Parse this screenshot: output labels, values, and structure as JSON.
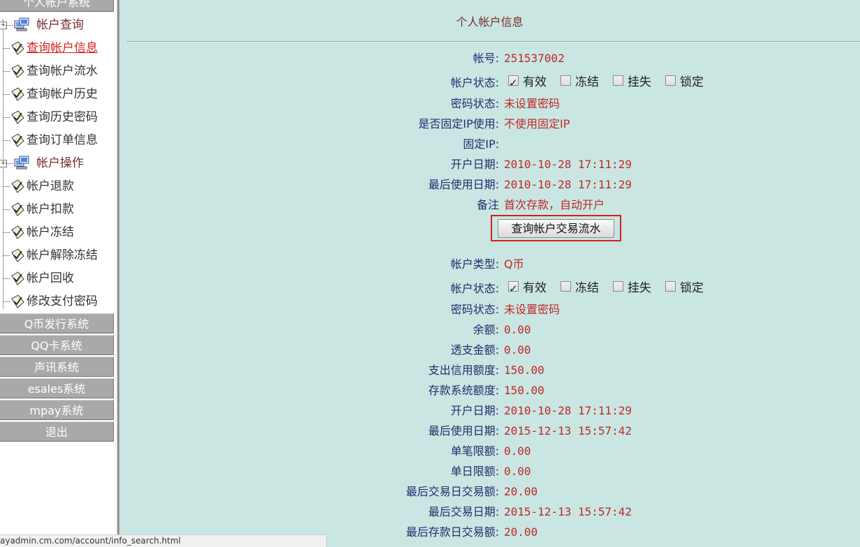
{
  "sidebar": {
    "top_system": "个人帐户系统",
    "group1": {
      "label": "帐户查询",
      "items": [
        "查询帐户信息",
        "查询帐户流水",
        "查询帐户历史",
        "查询历史密码",
        "查询订单信息"
      ]
    },
    "group2": {
      "label": "帐户操作",
      "items": [
        "帐户退款",
        "帐户扣款",
        "帐户冻结",
        "帐户解除冻结",
        "帐户回收",
        "修改支付密码"
      ]
    },
    "systems": [
      "Q币发行系统",
      "QQ卡系统",
      "声讯系统",
      "esales系统",
      "mpay系统",
      "退出"
    ]
  },
  "main": {
    "title": "个人帐户信息",
    "button_label": "查询帐户交易流水",
    "checkbox_options": [
      "有效",
      "冻结",
      "挂失",
      "锁定"
    ],
    "section1": {
      "account_no_label": "帐号:",
      "account_no": "251537002",
      "status_label": "帐户状态:",
      "status_checked": "有效",
      "pwd_status_label": "密码状态:",
      "pwd_status": "未设置密码",
      "fixed_ip_use_label": "是否固定IP使用:",
      "fixed_ip_use": "不使用固定IP",
      "fixed_ip_label": "固定IP:",
      "fixed_ip": "",
      "open_date_label": "开户日期:",
      "open_date": "2010-10-28 17:11:29",
      "last_use_label": "最后使用日期:",
      "last_use": "2010-10-28 17:11:29",
      "remark_label": "备注",
      "remark": "首次存款，自动开户"
    },
    "section2": {
      "type_label": "帐户类型:",
      "type": "Q币",
      "status_label": "帐户状态:",
      "status_checked": "有效",
      "pwd_status_label": "密码状态:",
      "pwd_status": "未设置密码",
      "balance_label": "余额:",
      "balance": "0.00",
      "overdraft_label": "透支金额:",
      "overdraft": "0.00",
      "credit_label": "支出信用额度:",
      "credit": "150.00",
      "deposit_limit_label": "存款系统额度:",
      "deposit_limit": "150.00",
      "open_date_label": "开户日期:",
      "open_date": "2010-10-28 17:11:29",
      "last_use_label": "最后使用日期:",
      "last_use": "2015-12-13 15:57:42",
      "single_limit_label": "单笔限额:",
      "single_limit": "0.00",
      "daily_limit_label": "单日限额:",
      "daily_limit": "0.00",
      "last_trade_amount_label": "最后交易日交易额:",
      "last_trade_amount": "20.00",
      "last_trade_date_label": "最后交易日期:",
      "last_trade_date": "2015-12-13 15:57:42",
      "last_deposit_amount_label": "最后存款日交易额:",
      "last_deposit_amount": "20.00"
    }
  },
  "statusbar": {
    "url": "ayadmin.cm.com/account/info_search.html"
  },
  "colors": {
    "background": "#c9e6e2",
    "label": "#1f2f6e",
    "value": "#c02828",
    "highlight": "#d81c1c"
  }
}
